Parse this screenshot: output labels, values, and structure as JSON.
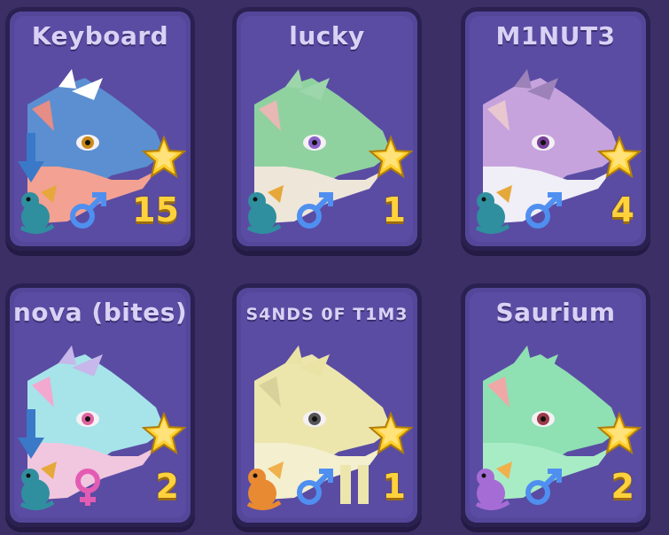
{
  "pets": [
    {
      "name": "Keyboard",
      "level": "15",
      "gender": "male",
      "species": "wyvern-teal",
      "arrow": true,
      "extra": false,
      "colors": {
        "main": "#5b8fd1",
        "belly": "#f2a192",
        "spikes": "#ffffff",
        "eye": "#c98a16",
        "accent": "#e58d86"
      }
    },
    {
      "name": "lucky",
      "level": "1",
      "gender": "male",
      "species": "wyvern-teal",
      "arrow": false,
      "extra": false,
      "colors": {
        "main": "#8fd2a0",
        "belly": "#eee6d9",
        "spikes": "#9dd6ab",
        "eye": "#8a62c8",
        "accent": "#e7b8b4"
      }
    },
    {
      "name": "M1NUT3",
      "level": "4",
      "gender": "male",
      "species": "wyvern-teal",
      "arrow": false,
      "extra": false,
      "colors": {
        "main": "#c7a3dd",
        "belly": "#f0eef6",
        "spikes": "#9c82b8",
        "eye": "#7a3f9a",
        "accent": "#e8c7cf"
      }
    },
    {
      "name": "nova (bites)",
      "level": "2",
      "gender": "female",
      "species": "wyvern-teal",
      "arrow": true,
      "extra": false,
      "colors": {
        "main": "#a6e4ea",
        "belly": "#f0c7de",
        "spikes": "#c7b7ea",
        "eye": "#e062a0",
        "accent": "#f3a8cf"
      }
    },
    {
      "name": "S4NDS 0F T1M3",
      "level": "1",
      "gender": "male",
      "species": "dragon-orange",
      "arrow": false,
      "extra": true,
      "colors": {
        "main": "#ece6ad",
        "belly": "#f3efcf",
        "spikes": "#eae3a5",
        "eye": "#555",
        "accent": "#d9d19a"
      }
    },
    {
      "name": "Saurium",
      "level": "2",
      "gender": "male",
      "species": "dragon-purple",
      "arrow": false,
      "extra": false,
      "colors": {
        "main": "#8fe0b2",
        "belly": "#a8ecc5",
        "spikes": "#8fe0b2",
        "eye": "#9c3a48",
        "accent": "#f0a7a7"
      }
    }
  ]
}
